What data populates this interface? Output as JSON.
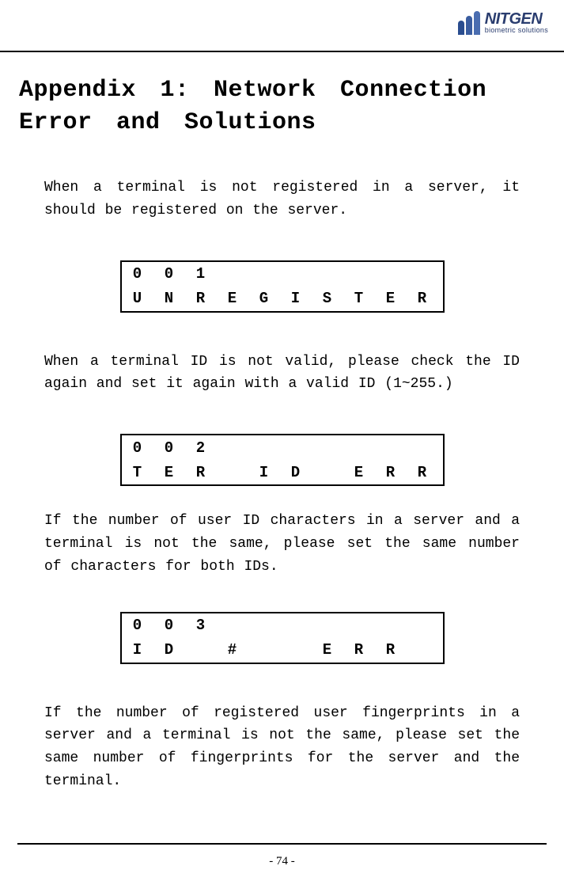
{
  "logo": {
    "name": "NITGEN",
    "tagline": "biometric solutions"
  },
  "title": "Appendix 1: Network Connection Error and Solutions",
  "paragraphs": {
    "p1": "When a terminal is not registered in a server, it should be registered on the server.",
    "p2": "When a terminal ID is not valid, please check the ID again and set it again with a valid ID (1~255.)",
    "p3": "If the number of user ID characters in a server and a terminal is not the same, please set the same number of characters for both IDs.",
    "p4": "If the number of registered user fingerprints in a server and a terminal is not the same, please set the same number of fingerprints for the server and the terminal."
  },
  "displays": {
    "d1": {
      "row1": [
        "0",
        "0",
        "1",
        "",
        "",
        "",
        "",
        "",
        "",
        ""
      ],
      "row2": [
        "U",
        "N",
        "R",
        "E",
        "G",
        "I",
        "S",
        "T",
        "E",
        "R"
      ]
    },
    "d2": {
      "row1": [
        "0",
        "0",
        "2",
        "",
        "",
        "",
        "",
        "",
        "",
        ""
      ],
      "row2": [
        "T",
        "E",
        "R",
        "",
        "I",
        "D",
        "",
        "E",
        "R",
        "R"
      ]
    },
    "d3": {
      "row1": [
        "0",
        "0",
        "3",
        "",
        "",
        "",
        "",
        "",
        "",
        ""
      ],
      "row2": [
        "I",
        "D",
        "",
        "#",
        "",
        "",
        "E",
        "R",
        "R",
        ""
      ]
    }
  },
  "pageNumber": "- 74 -"
}
